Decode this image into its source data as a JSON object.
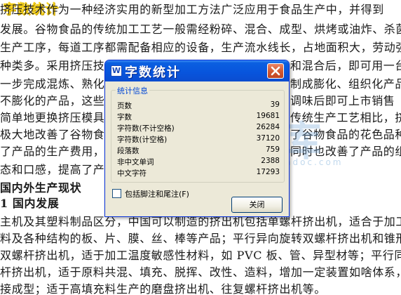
{
  "document": {
    "caption": "字数统计",
    "lines": [
      "  挤压技术作为一种经济实用的新型加工方法广泛应用于食品生产中，并得到",
      "发展。谷物食品的传统加工工艺一般需经粉碎、混合、成型、烘烤或油炸、杀菌、干",
      "生产工序，每道工序都需配备相应的设备，生产流水线长，占地面积大，劳动强度高",
      "种类多。采用挤压技术",
      "一步完成混炼、熟化、",
      "不膨化的产品，这些产",
      "简单地更换挤压模具，",
      "极大地改善了谷物食品",
      "了产品的生产费用，减",
      "态和口感，提高了产品"
    ],
    "lines_right": [
      "和混合后，即可用一台",
      "制成膨化、组织化产品",
      "调味后即可上市销售",
      "传统生产工艺相比，挤",
      "了谷物食品的花色品种",
      "同时也改善了产品的组"
    ],
    "heading1": "国内外生产现状",
    "heading2": "1  国内发展",
    "lines_bottom": [
      "主机及其塑料制品区分，中国可以制造的挤出机包括单螺杆挤出机，适合于加工",
      "料及各种结构的板、片、膜、丝、棒等产品；平行异向旋转双螺杆挤出机和锥形异",
      "双螺杆挤出机，适于加工温度敏感性材料，如 PVC 板、管、异型材等；平行同向旋",
      "杆挤出机，适于原料共混、填充、脱挥、改性、造料，增加一定装置如啥体系，可",
      "接成型；适于高填充料生产的磨盘挤出机、往复螺杆挤出机等。"
    ]
  },
  "watermark": {
    "chars": [
      "水",
      "文",
      "库"
    ],
    "url": "www.renrendoc.com"
  },
  "dialog": {
    "title": "字数统计",
    "icon_letter": "W",
    "group_label": "统计信息",
    "stats": [
      {
        "label": "页数",
        "value": "39"
      },
      {
        "label": "字数",
        "value": "19681"
      },
      {
        "label": "字符数(不计空格)",
        "value": "26284"
      },
      {
        "label": "字符数(计空格)",
        "value": "37120"
      },
      {
        "label": "段落数",
        "value": "759"
      },
      {
        "label": "非中文单词",
        "value": "2388"
      },
      {
        "label": "中文字符",
        "value": "17293"
      }
    ],
    "checkbox_label": "包括脚注和尾注(F)",
    "checkbox_checked": false,
    "ok_label": "关闭"
  },
  "colors": {
    "titlebar": "#0854dc",
    "close_button": "#d45a32",
    "dialog_face": "#ece9d8",
    "group_label": "#0046d5",
    "caption": "#f5d21a"
  }
}
